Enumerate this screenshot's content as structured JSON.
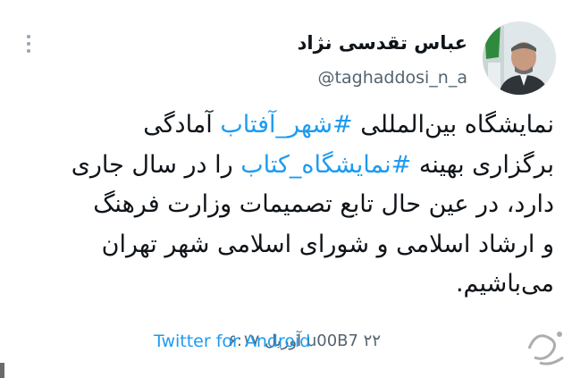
{
  "author": {
    "name": "عباس تقدسی نژاد",
    "handle": "@taghaddosi_n_a"
  },
  "tweet": {
    "lines": [
      [
        "نمایشگاه بین‌المللی ",
        {
          "tag": "#شهر_آفتاب"
        },
        " آمادگی"
      ],
      [
        "برگزاری بهینه ",
        {
          "tag": "#نمایشگاه_کتاب"
        },
        " را در سال جاری"
      ],
      [
        "دارد، در عین حال تابع تصمیمات وزارت فرهنگ"
      ],
      [
        "و ارشاد اسلامی و شورای اسلامی شهر تهران"
      ],
      [
        "می‌باشیم."
      ]
    ]
  },
  "meta": {
    "date_text": "u00B7 ۲۲ آوریل ۰۶:۱۷",
    "source": "Twitter for Android"
  },
  "icons": {
    "more": "more-horizontal-icon",
    "watermark": "site-logo-watermark"
  },
  "colors": {
    "link": "#1d9bf0",
    "text": "#0f1419",
    "muted": "#536471"
  }
}
